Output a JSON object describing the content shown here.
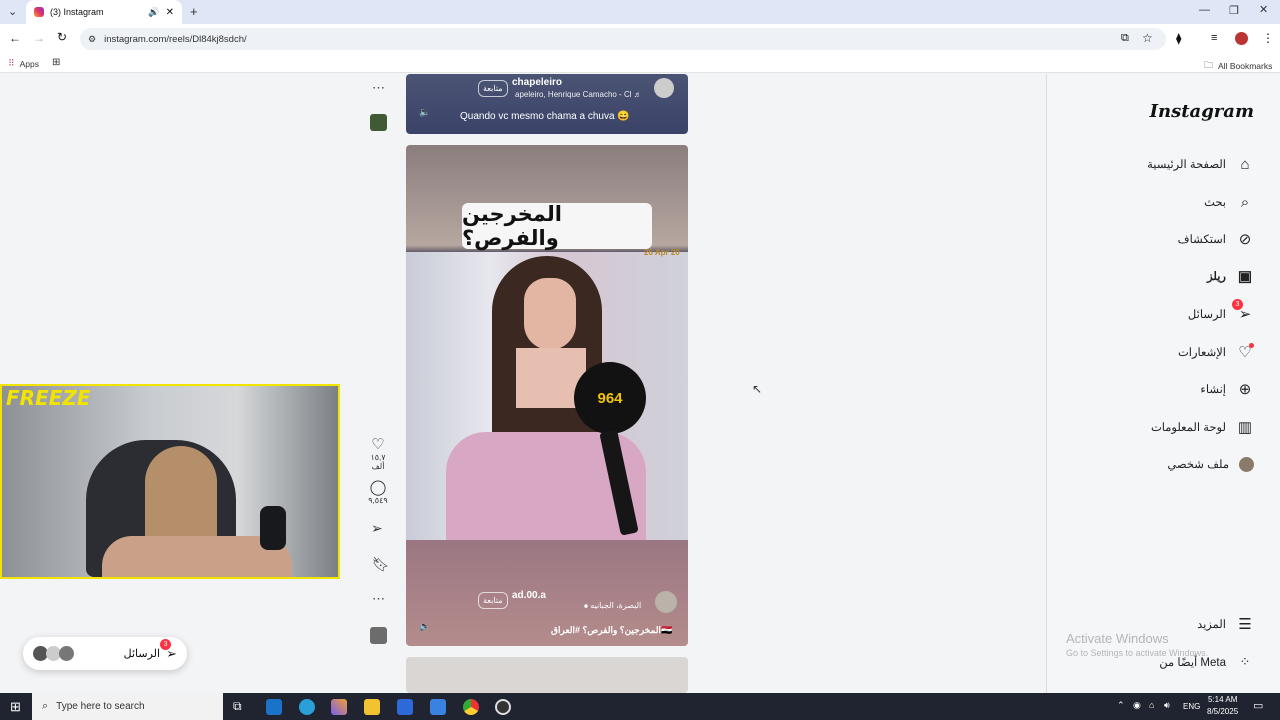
{
  "browser": {
    "tab_title": "(3) Instagram",
    "url": "instagram.com/reels/Dl84kj8sdch/",
    "bookmarks_apps": "Apps",
    "bookmarks_all": "All Bookmarks"
  },
  "sidebar": {
    "logo": "Instagram",
    "items": [
      {
        "label": "الصفحة الرئيسية",
        "icon": "home-icon"
      },
      {
        "label": "بحث",
        "icon": "search-icon"
      },
      {
        "label": "استكشاف",
        "icon": "compass-icon"
      },
      {
        "label": "ريلز",
        "icon": "reels-icon"
      },
      {
        "label": "الرسائل",
        "icon": "messages-icon",
        "badge": "3"
      },
      {
        "label": "الإشعارات",
        "icon": "heart-icon"
      },
      {
        "label": "إنشاء",
        "icon": "plus-icon"
      },
      {
        "label": "لوحة المعلومات",
        "icon": "dashboard-icon"
      },
      {
        "label": "ملف شخصي",
        "icon": "avatar-icon"
      }
    ],
    "more": "المزيد",
    "also_from_meta": "أيضًا من Meta"
  },
  "reel_top": {
    "follow": "متابعة",
    "username": "chapeleiro",
    "audio": "apeleiro, Henrique Camacho - Cl ♬",
    "caption": "Quando vc mesmo chama a chuva 😄"
  },
  "reel_main": {
    "overlay_text": "المخرجين والفرص؟",
    "date_stamp": "26 Apr 20",
    "mic_label": "964",
    "username": "ad.00.a",
    "follow": "متابعة",
    "location": "البصرة، الجبانيه",
    "caption": "المخرجين؟ والفرص؟ #العراق🇮🇶"
  },
  "actions": {
    "likes": "١٥,٧ ألف",
    "comments": "٩,٥٤٩"
  },
  "messages_pill": {
    "label": "الرسائل",
    "badge": "3"
  },
  "webcam": {
    "freeze_text": "FREEZE"
  },
  "watermark": {
    "title": "Activate Windows",
    "subtitle": "Go to Settings to activate Windows."
  },
  "taskbar": {
    "search_placeholder": "Type here to search",
    "lang": "ENG",
    "time": "5:14 AM",
    "date": "8/5/2025"
  }
}
